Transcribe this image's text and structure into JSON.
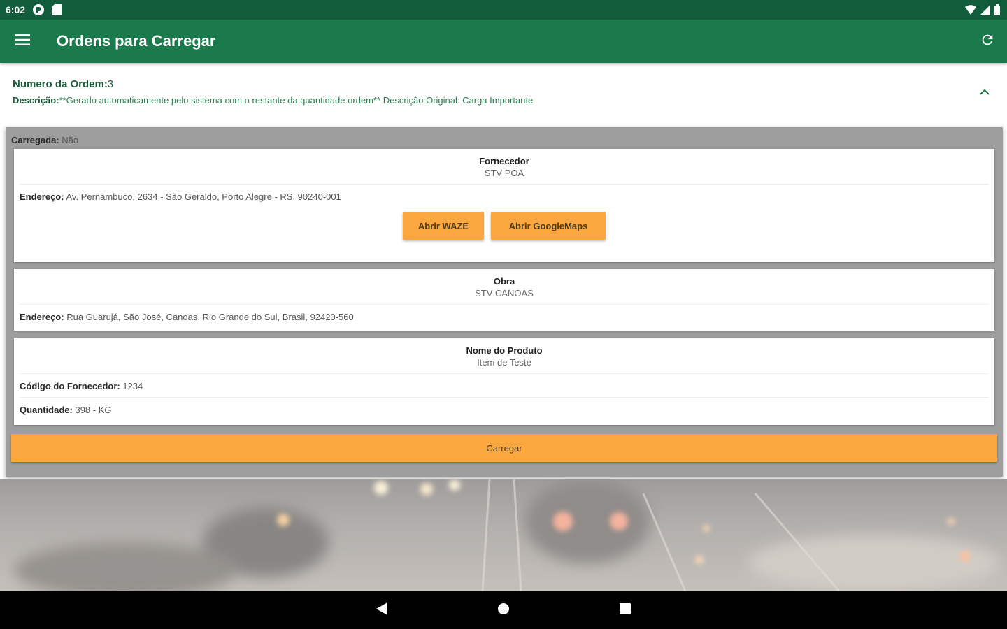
{
  "status_bar": {
    "time": "6:02"
  },
  "app_bar": {
    "title": "Ordens para Carregar",
    "menu_icon": "hamburger-menu-icon",
    "refresh_icon": "refresh-icon"
  },
  "order": {
    "number_label": "Numero da Ordem:",
    "number_value": "3",
    "description_label": "Descrição:",
    "description_value": "**Gerado automaticamente pelo sistema com o restante da quantidade ordem** Descrição Original: Carga Importante"
  },
  "detail": {
    "loaded_label": "Carregada:",
    "loaded_value": "Não",
    "supplier": {
      "title": "Fornecedor",
      "value": "STV POA",
      "address_label": "Endereço:",
      "address_value": "Av. Pernambuco, 2634 - São Geraldo, Porto Alegre - RS, 90240-001",
      "waze_button": "Abrir WAZE",
      "maps_button": "Abrir GoogleMaps"
    },
    "site": {
      "title": "Obra",
      "value": "STV CANOAS",
      "address_label": "Endereço:",
      "address_value": "Rua Guarujá, São José, Canoas, Rio Grande do Sul, Brasil, 92420-560"
    },
    "product": {
      "title": "Nome do Produto",
      "value": "Item de Teste",
      "supplier_code_label": "Código do Fornecedor:",
      "supplier_code_value": "1234",
      "quantity_label": "Quantidade:",
      "quantity_value": "398 - KG"
    },
    "load_button": "Carregar"
  },
  "colors": {
    "status_bar": "#115c3a",
    "app_bar": "#1a7a4c",
    "accent_orange": "#f9a73e",
    "panel_gray": "#9e9e9e"
  }
}
